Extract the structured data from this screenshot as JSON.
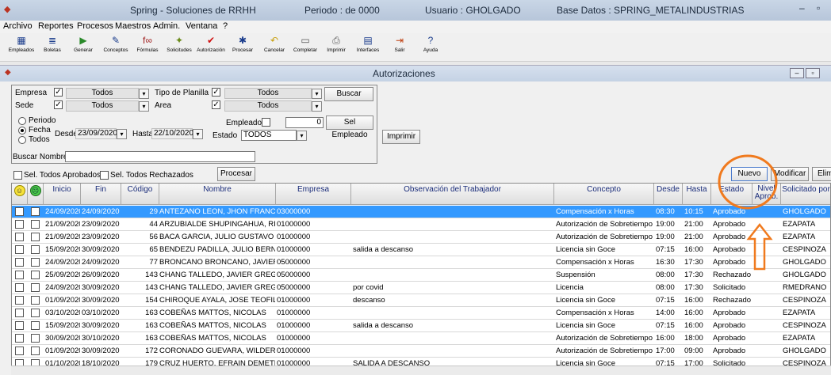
{
  "app": {
    "title": "Spring - Soluciones de RRHH",
    "periodo": "Periodo :  de 0000",
    "usuario": "Usuario : GHOLGADO",
    "base_datos": "Base Datos : SPRING_METALINDUSTRIAS"
  },
  "menu": [
    "Archivo",
    "Reportes",
    "Procesos",
    "Maestros",
    "Admin.",
    "Ventana",
    "?"
  ],
  "toolbar": [
    {
      "label": "Empleados",
      "icon": "employees-icon"
    },
    {
      "label": "Boletas",
      "icon": "payslip-icon"
    },
    {
      "label": "Generar",
      "icon": "generate-icon"
    },
    {
      "label": "Conceptos",
      "icon": "concepts-icon"
    },
    {
      "label": "Fórmulas",
      "icon": "formula-icon"
    },
    {
      "label": "Solicitudes",
      "icon": "requests-icon"
    },
    {
      "label": "Autorización",
      "icon": "checkmark-icon"
    },
    {
      "label": "Procesar",
      "icon": "runner-icon"
    },
    {
      "label": "Cancelar",
      "icon": "undo-icon"
    },
    {
      "label": "Completar",
      "icon": "complete-icon"
    },
    {
      "label": "Imprimir",
      "icon": "printer-icon"
    },
    {
      "label": "Interfaces",
      "icon": "interfaces-icon"
    },
    {
      "label": "Salir",
      "icon": "exit-icon"
    },
    {
      "label": "Ayuda",
      "icon": "help-icon"
    }
  ],
  "window": {
    "title": "Autorizaciones"
  },
  "filters": {
    "empresa_label": "Empresa",
    "empresa_value": "Todos",
    "tipo_planilla_label": "Tipo de Planilla",
    "tipo_planilla_value": "Todos",
    "sede_label": "Sede",
    "sede_value": "Todos",
    "area_label": "Area",
    "area_value": "Todos",
    "buscar_button": "Buscar",
    "periodo_radio": "Periodo",
    "fecha_radio": "Fecha",
    "todos_radio": "Todos",
    "desde_label": "Desde",
    "desde_value": "23/09/2020",
    "hasta_label": "Hasta",
    "hasta_value": "22/10/2020",
    "empleado_label": "Empleado",
    "empleado_value": "0",
    "sel_empleado_button": "Sel Empleado",
    "estado_label": "Estado",
    "estado_value": "TODOS",
    "imprimir_button": "Imprimir"
  },
  "search": {
    "label": "Buscar Nombre",
    "value": ""
  },
  "actions": {
    "sel_aprobados": "Sel. Todos Aprobados",
    "sel_rechazados": "Sel. Todos Rechazados",
    "procesar": "Procesar",
    "nuevo": "Nuevo",
    "modificar": "Modificar",
    "eliminar": "Elim"
  },
  "table": {
    "headers": [
      "Inicio",
      "Fin",
      "Código",
      "Nombre",
      "Empresa",
      "Observación del Trabajador",
      "Concepto",
      "Desde",
      "Hasta",
      "Estado",
      "Nivel Aprob.",
      "Solicitado por"
    ],
    "rows": [
      {
        "inicio": "24/09/2020",
        "fin": "24/09/2020",
        "codigo": "29",
        "nombre": "ANTEZANO LEON, JHON  FRANCISCO",
        "empresa": "03000000",
        "obs": "",
        "concepto": "Compensación x Horas",
        "desde": "08:30",
        "hasta": "10:15",
        "estado": "Aprobado",
        "solicitado": "GHOLGADO"
      },
      {
        "inicio": "21/09/2020",
        "fin": "23/09/2020",
        "codigo": "44",
        "nombre": "ARZUBIALDE SHUPINGAHUA, RICARDO",
        "empresa": "01000000",
        "obs": "",
        "concepto": "Autorización de Sobretiempos",
        "desde": "19:00",
        "hasta": "21:00",
        "estado": "Aprobado",
        "solicitado": "EZAPATA"
      },
      {
        "inicio": "21/09/2020",
        "fin": "23/09/2020",
        "codigo": "56",
        "nombre": "BACA GARCIA, JULIO  GUSTAVO",
        "empresa": "01000000",
        "obs": "",
        "concepto": "Autorización de Sobretiempos",
        "desde": "19:00",
        "hasta": "21:00",
        "estado": "Aprobado",
        "solicitado": "EZAPATA"
      },
      {
        "inicio": "15/09/2020",
        "fin": "30/09/2020",
        "codigo": "65",
        "nombre": "BENDEZU PADILLA, JULIO  BERNARDO",
        "empresa": "01000000",
        "obs": "salida a descanso",
        "concepto": "Licencia sin Goce",
        "desde": "07:15",
        "hasta": "16:00",
        "estado": "Aprobado",
        "solicitado": "CESPINOZA"
      },
      {
        "inicio": "24/09/2020",
        "fin": "24/09/2020",
        "codigo": "77",
        "nombre": "BRONCANO BRONCANO, JAVIER OMAR",
        "empresa": "05000000",
        "obs": "",
        "concepto": "Compensación x Horas",
        "desde": "16:30",
        "hasta": "17:30",
        "estado": "Aprobado",
        "solicitado": "GHOLGADO"
      },
      {
        "inicio": "25/09/2020",
        "fin": "26/09/2020",
        "codigo": "143",
        "nombre": "CHANG TALLEDO, JAVIER  GREGORIO",
        "empresa": "05000000",
        "obs": "",
        "concepto": "Suspensión",
        "desde": "08:00",
        "hasta": "17:30",
        "estado": "Rechazado",
        "solicitado": "GHOLGADO"
      },
      {
        "inicio": "24/09/2020",
        "fin": "30/09/2020",
        "codigo": "143",
        "nombre": "CHANG TALLEDO, JAVIER  GREGORIO",
        "empresa": "05000000",
        "obs": "por covid",
        "concepto": "Licencia",
        "desde": "08:00",
        "hasta": "17:30",
        "estado": "Solicitado",
        "solicitado": "RMEDRANO"
      },
      {
        "inicio": "01/09/2020",
        "fin": "30/09/2020",
        "codigo": "154",
        "nombre": "CHIROQUE AYALA, JOSE  TEOFILO",
        "empresa": "01000000",
        "obs": "descanso",
        "concepto": "Licencia sin Goce",
        "desde": "07:15",
        "hasta": "16:00",
        "estado": "Rechazado",
        "solicitado": "CESPINOZA"
      },
      {
        "inicio": "03/10/2020",
        "fin": "03/10/2020",
        "codigo": "163",
        "nombre": "COBEÑAS MATTOS, NICOLAS",
        "empresa": "01000000",
        "obs": "",
        "concepto": "Compensación x Horas",
        "desde": "14:00",
        "hasta": "16:00",
        "estado": "Aprobado",
        "solicitado": "EZAPATA"
      },
      {
        "inicio": "15/09/2020",
        "fin": "30/09/2020",
        "codigo": "163",
        "nombre": "COBEÑAS MATTOS, NICOLAS",
        "empresa": "01000000",
        "obs": "salida a descanso",
        "concepto": "Licencia sin Goce",
        "desde": "07:15",
        "hasta": "16:00",
        "estado": "Aprobado",
        "solicitado": "CESPINOZA"
      },
      {
        "inicio": "30/09/2020",
        "fin": "30/10/2020",
        "codigo": "163",
        "nombre": "COBEÑAS MATTOS, NICOLAS",
        "empresa": "01000000",
        "obs": "",
        "concepto": "Autorización de Sobretiempos",
        "desde": "16:00",
        "hasta": "18:00",
        "estado": "Aprobado",
        "solicitado": "EZAPATA"
      },
      {
        "inicio": "01/09/2020",
        "fin": "30/09/2020",
        "codigo": "172",
        "nombre": "CORONADO GUEVARA, WILDER",
        "empresa": "01000000",
        "obs": "",
        "concepto": "Autorización de Sobretiempos",
        "desde": "17:00",
        "hasta": "09:00",
        "estado": "Aprobado",
        "solicitado": "GHOLGADO"
      },
      {
        "inicio": "01/10/2020",
        "fin": "18/10/2020",
        "codigo": "179",
        "nombre": "CRUZ HUERTO, EFRAIN  DEMETRIO",
        "empresa": "01000000",
        "obs": "SALIDA A DESCANSO",
        "concepto": "Licencia sin Goce",
        "desde": "07:15",
        "hasta": "17:00",
        "estado": "Solicitado",
        "solicitado": "CESPINOZA"
      }
    ]
  },
  "colors": {
    "selection": "#3399ff",
    "header_text": "#1b2d7a",
    "highlight": "#f07a1e"
  }
}
